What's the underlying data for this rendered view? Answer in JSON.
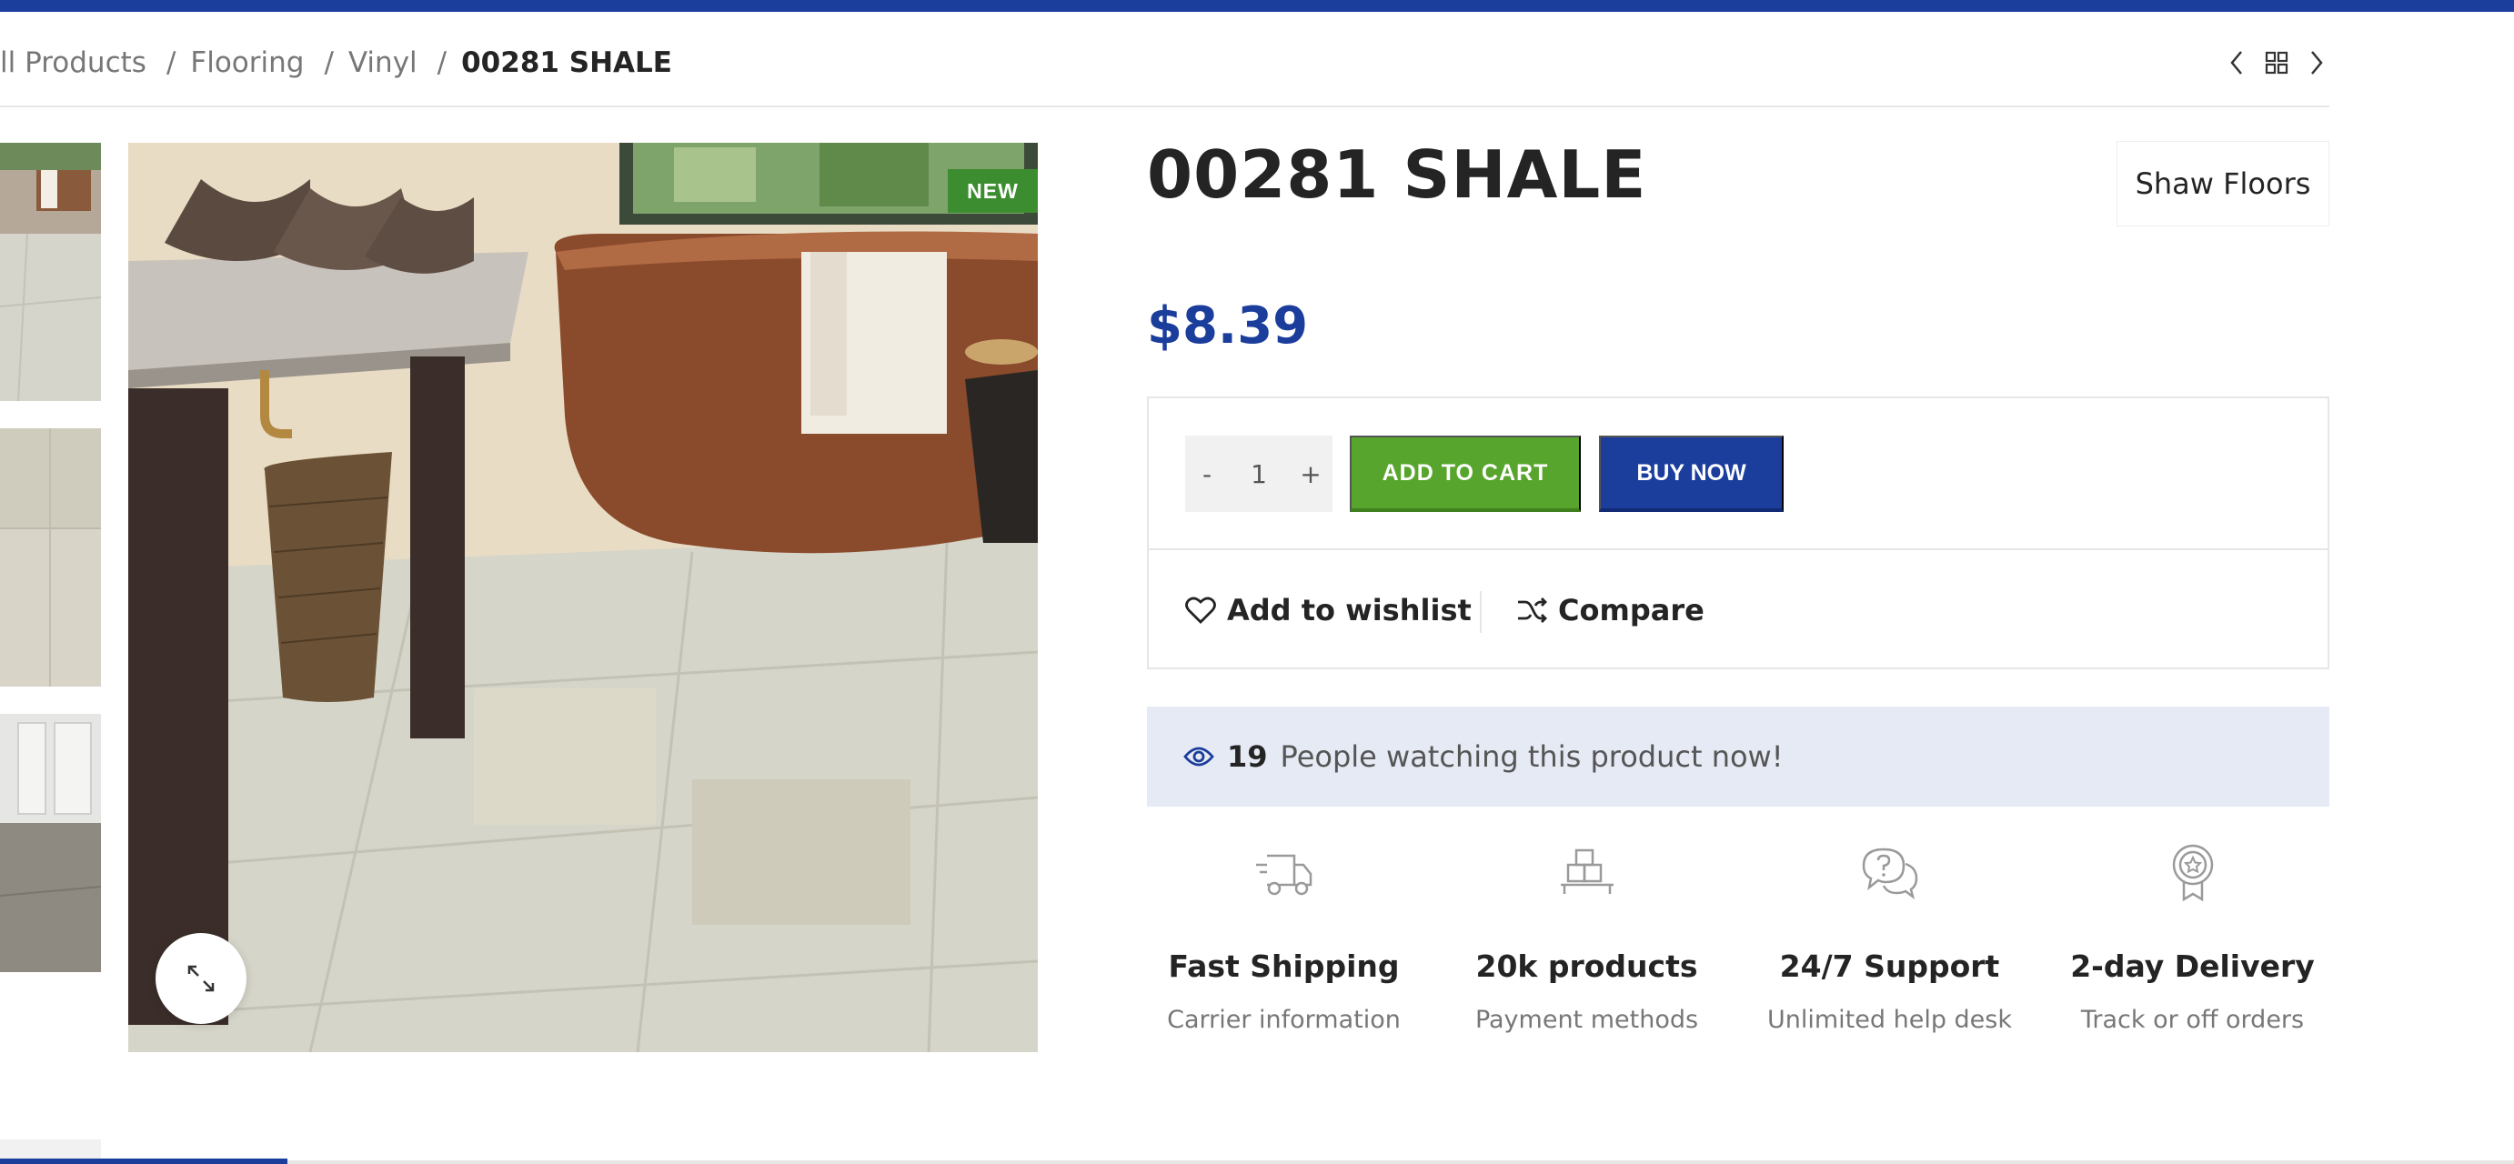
{
  "breadcrumb": {
    "items": [
      "ll Products",
      "Flooring",
      "Vinyl"
    ],
    "current": "00281 SHALE"
  },
  "gallery": {
    "badge": "NEW"
  },
  "product": {
    "title": "00281 SHALE",
    "brand": "Shaw Floors",
    "price": "$8.39"
  },
  "cart": {
    "minus": "-",
    "quantity": "1",
    "plus": "+",
    "add_to_cart": "ADD TO CART",
    "buy_now": "BUY NOW"
  },
  "actions": {
    "wishlist": "Add to wishlist",
    "compare": "Compare"
  },
  "watching": {
    "count": "19",
    "text": "People watching this product now!"
  },
  "features": [
    {
      "icon": "truck-icon",
      "title": "Fast Shipping",
      "subtitle": "Carrier information"
    },
    {
      "icon": "boxes-icon",
      "title": "20k products",
      "subtitle": "Payment methods"
    },
    {
      "icon": "support-chat-icon",
      "title": "24/7 Support",
      "subtitle": "Unlimited help desk"
    },
    {
      "icon": "award-icon",
      "title": "2-day Delivery",
      "subtitle": "Track or off orders"
    }
  ],
  "colors": {
    "brand_blue": "#1b3d9b",
    "cart_green": "#58a52d",
    "badge_green": "#3c8d2f",
    "watching_bg": "#e6eaf5"
  }
}
